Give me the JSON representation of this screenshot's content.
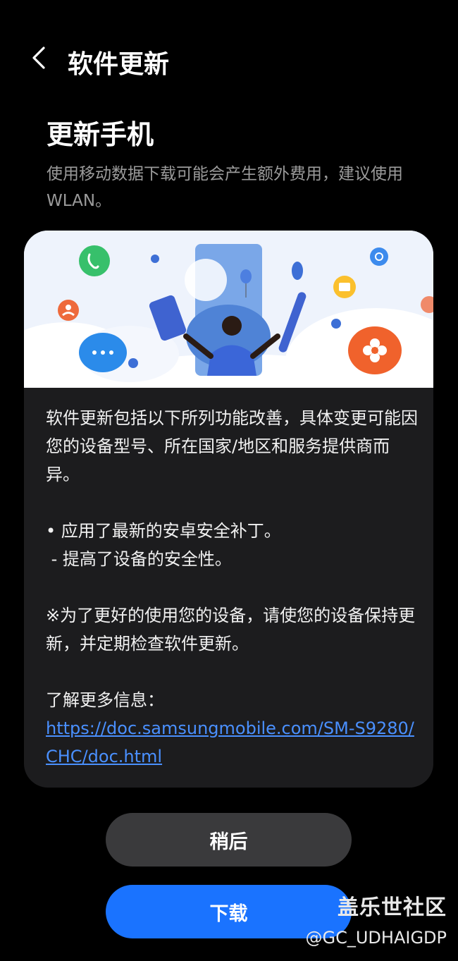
{
  "header": {
    "title": "软件更新"
  },
  "main": {
    "heading": "更新手机",
    "subtitle": "使用移动数据下载可能会产生额外费用，建议使用 WLAN。"
  },
  "card": {
    "intro": "软件更新包括以下所列功能改善，具体变更可能因您的设备型号、所在国家/地区和服务提供商而异。",
    "bullet": "• 应用了最新的安卓安全补丁。",
    "sub_bullet": " - 提高了设备的安全性。",
    "note": "※为了更好的使用您的设备，请使您的设备保持更新，并定期检查软件更新。",
    "more_info_label": "了解更多信息：",
    "link": "https://doc.samsungmobile.com/SM-S9280/CHC/doc.html"
  },
  "buttons": {
    "later": "稍后",
    "download": "下载"
  },
  "watermark": {
    "title": "盖乐世社区",
    "handle": "@GC_UDHAIGDP"
  },
  "colors": {
    "accent": "#1a73ff",
    "link": "#4a90ff",
    "card_bg": "#1c1c1e"
  },
  "icons": [
    "back-icon",
    "phone-icon",
    "chat-icon",
    "person-icon",
    "settings-icon",
    "folder-icon",
    "flower-icon"
  ]
}
